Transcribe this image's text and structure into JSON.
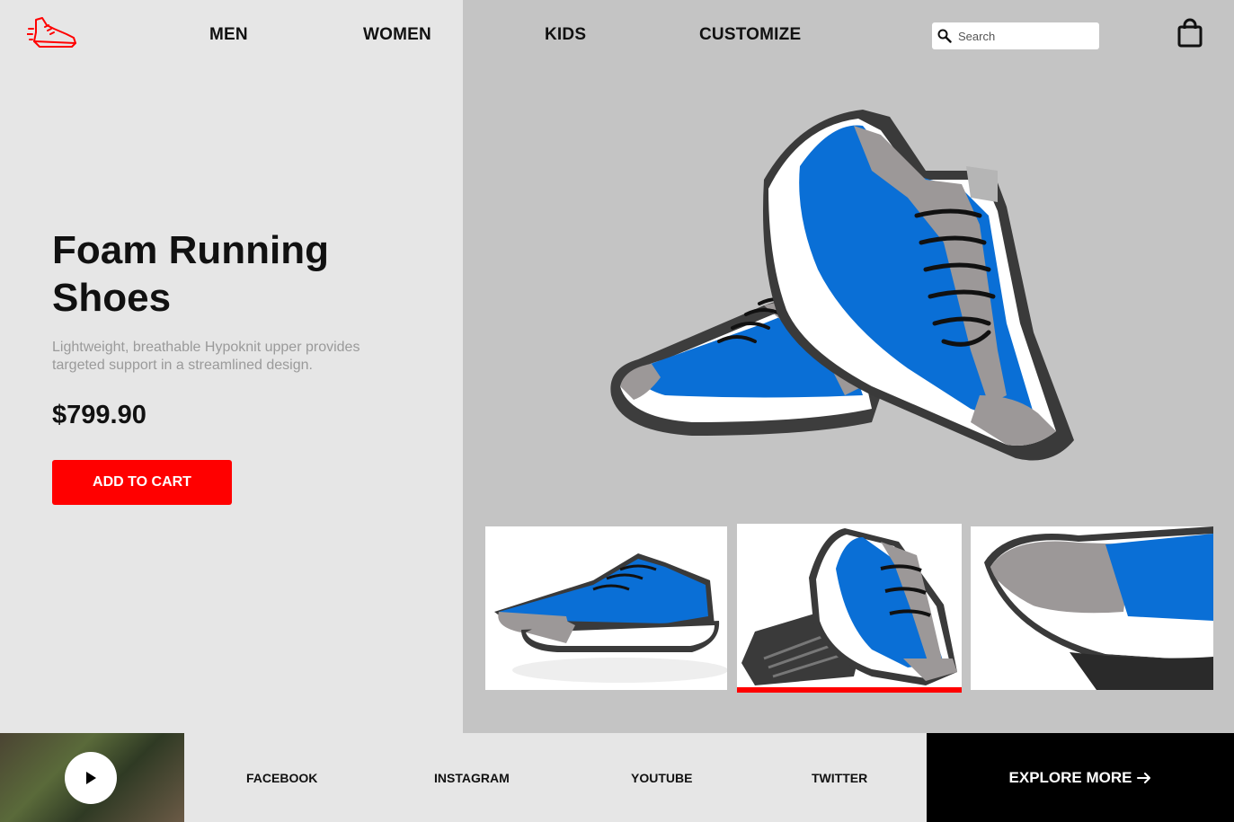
{
  "header": {
    "logo_icon": "running-shoe-logo-icon",
    "nav": [
      "MEN",
      "WOMEN",
      "KIDS",
      "CUSTOMIZE"
    ],
    "search": {
      "placeholder": "Search",
      "value": "",
      "icon": "search-icon"
    },
    "cart_icon": "shopping-bag-icon"
  },
  "product": {
    "title": "Foam Running Shoes",
    "description": "Lightweight, breathable Hypoknit upper provides targeted support in a streamlined design.",
    "price": "$799.90",
    "add_to_cart_label": "ADD TO CART"
  },
  "gallery": {
    "thumbnails": [
      "shoe-pair-side-view",
      "shoe-pair-sole-view",
      "shoe-heel-closeup"
    ],
    "active_index": 1
  },
  "footer": {
    "video_icon": "play-icon",
    "social_links": [
      "FACEBOOK",
      "INSTAGRAM",
      "YOUTUBE",
      "TWITTER"
    ],
    "explore_label": "EXPLORE MORE",
    "explore_icon": "arrow-right-icon"
  },
  "colors": {
    "accent": "#ff0000",
    "left_bg": "#e6e6e6",
    "right_bg": "#c4c4c4",
    "shoe_blue": "#0a6fd6",
    "footer_dark": "#000000"
  }
}
